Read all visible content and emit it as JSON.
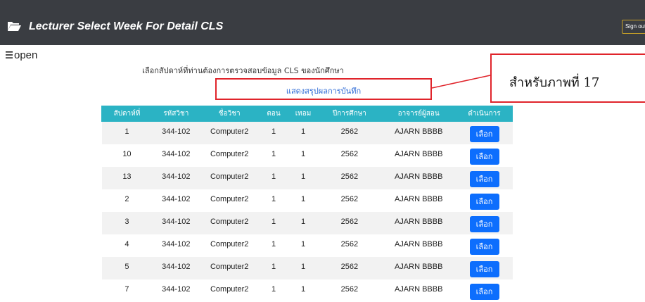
{
  "header": {
    "title": "Lecturer Select Week For Detail CLS",
    "signout_label": "Sign out"
  },
  "open_label": "open",
  "instruction": "เลือกสัปดาห์ที่ท่านต้องการตรวจสอบข้อมูล CLS ของนักศึกษา",
  "summary_link": "แสดงสรุปผลการบันทึก",
  "callout": "สำหรับภาพที่ 17",
  "colors": {
    "topbar": "#3a3d42",
    "table_header": "#2bb3c4",
    "button": "#0d6efd",
    "annotation": "#e0242b"
  },
  "table": {
    "headers": [
      "สัปดาห์ที่",
      "รหัสวิชา",
      "ชื่อวิชา",
      "ตอน",
      "เทอม",
      "ปีการศึกษา",
      "อาจารย์ผู้สอน",
      "ดำเนินการ"
    ],
    "button_label": "เลือก",
    "rows": [
      [
        "1",
        "344-102",
        "Computer2",
        "1",
        "1",
        "2562",
        "AJARN BBBB"
      ],
      [
        "10",
        "344-102",
        "Computer2",
        "1",
        "1",
        "2562",
        "AJARN BBBB"
      ],
      [
        "13",
        "344-102",
        "Computer2",
        "1",
        "1",
        "2562",
        "AJARN BBBB"
      ],
      [
        "2",
        "344-102",
        "Computer2",
        "1",
        "1",
        "2562",
        "AJARN BBBB"
      ],
      [
        "3",
        "344-102",
        "Computer2",
        "1",
        "1",
        "2562",
        "AJARN BBBB"
      ],
      [
        "4",
        "344-102",
        "Computer2",
        "1",
        "1",
        "2562",
        "AJARN BBBB"
      ],
      [
        "5",
        "344-102",
        "Computer2",
        "1",
        "1",
        "2562",
        "AJARN BBBB"
      ],
      [
        "7",
        "344-102",
        "Computer2",
        "1",
        "1",
        "2562",
        "AJARN BBBB"
      ]
    ]
  }
}
